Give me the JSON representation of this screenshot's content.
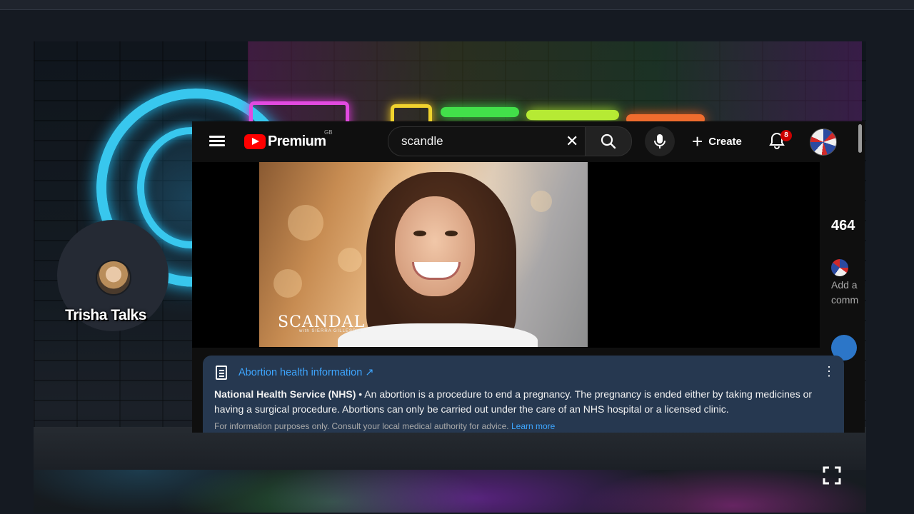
{
  "stream": {
    "streamer_name": "Trisha Talks"
  },
  "youtube": {
    "logo_text": "Premium",
    "region": "GB",
    "search": {
      "query": "scandle"
    },
    "create_label": "Create",
    "notification_count": "8",
    "video": {
      "brand_logo": "SCANDAL",
      "brand_subtitle": "with SIERRA GILLESPIE"
    },
    "side": {
      "count": "464",
      "add_comment": "Add a\ncomm"
    },
    "info_panel": {
      "title": "Abortion health information ↗",
      "source": "National Health Service (NHS)",
      "body": " • An abortion is a procedure to end a pregnancy. The pregnancy is ended either by taking medicines or having a surgical procedure. Abortions can only be carried out under the care of an NHS hospital or a licensed clinic.",
      "disclaimer": "For information purposes only. Consult your local medical authority for advice.",
      "learn_more": "Learn more"
    }
  },
  "icons": [
    "menu-icon",
    "youtube-logo-icon",
    "clear-icon",
    "search-icon",
    "mic-icon",
    "plus-icon",
    "bell-icon",
    "document-icon",
    "more-vert-icon",
    "fullscreen-icon"
  ],
  "colors": {
    "youtube_red": "#ff0000",
    "link_blue": "#3ea6ff",
    "panel_bg": "#263850",
    "neon_cyan": "#38c7ee"
  }
}
